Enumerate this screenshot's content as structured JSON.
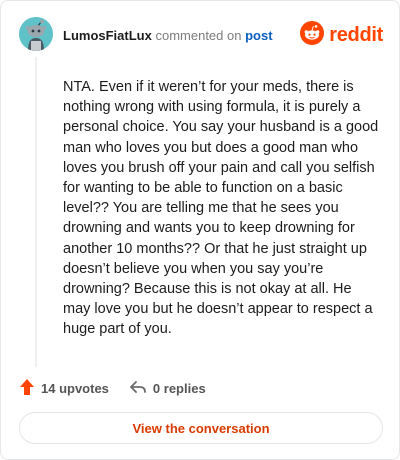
{
  "header": {
    "username": "LumosFiatLux",
    "action_text": "commented on",
    "post_link": "post",
    "brand": "reddit"
  },
  "comment": {
    "text": "NTA. Even if it weren’t for your meds, there is nothing wrong with using formula, it is purely a personal choice. You say your husband is a good man who loves you but does a good man who loves you brush off your pain and call you selfish for wanting to be able to function on a basic level?? You are telling me that he sees you drowning and wants you to keep drowning for another 10 months?? Or that he just straight up doesn’t believe you when you say you’re drowning? Because this is not okay at all. He may love you but he doesn’t appear to respect a huge part of you."
  },
  "actions": {
    "upvotes": "14 upvotes",
    "replies": "0 replies"
  },
  "cta": {
    "label": "View the conversation"
  },
  "colors": {
    "brand": "#ff4500",
    "link": "#0b5fbf",
    "avatar_bg": "#5fc2c8",
    "cta_text": "#d93a00"
  },
  "icons": {
    "avatar": "snoo-avatar-icon",
    "logo": "reddit-logo-icon",
    "upvote": "upvote-arrow-icon",
    "reply": "reply-arrow-icon"
  }
}
